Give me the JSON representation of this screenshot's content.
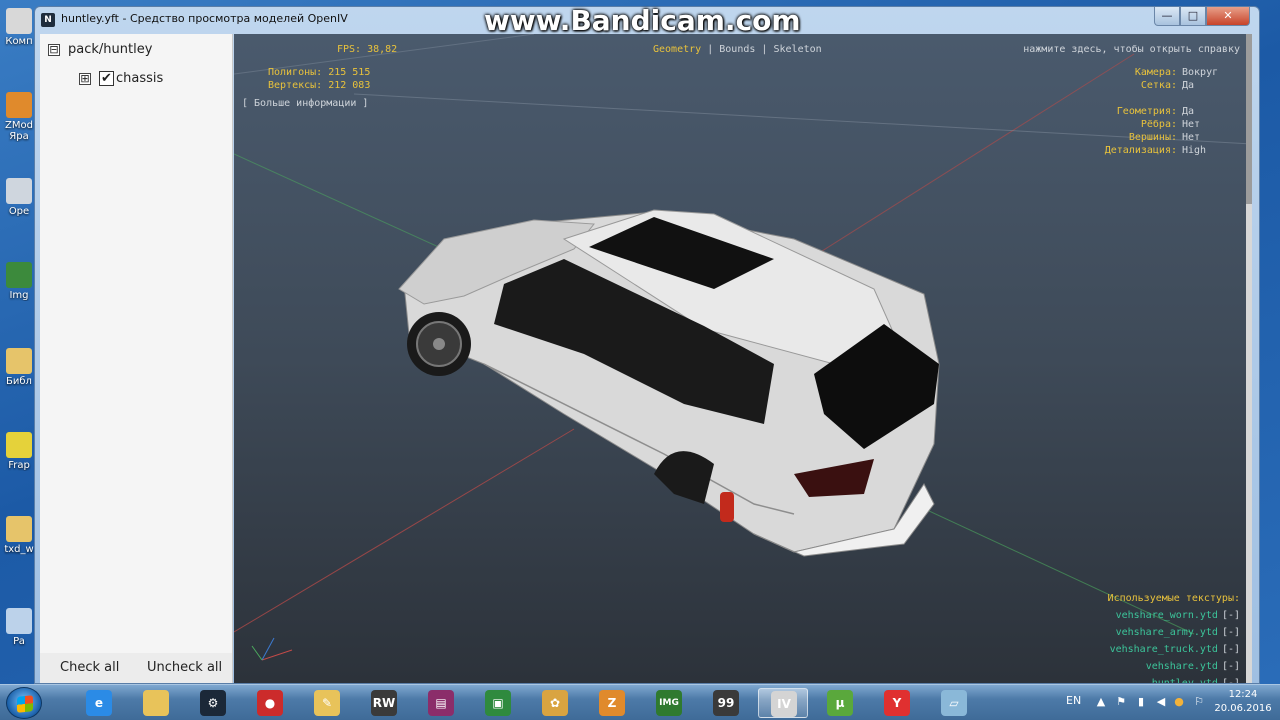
{
  "watermark": "www.Bandicam.com",
  "window": {
    "title": "huntley.yft - Средство просмотра моделей OpenIV",
    "app_icon": "N",
    "controls": {
      "minimize": "—",
      "maximize": "□",
      "close": "✕"
    }
  },
  "tree": {
    "root": {
      "expander": "⊟",
      "label": "pack/huntley"
    },
    "children": [
      {
        "expander": "⊞",
        "checked": "✔",
        "label": "chassis"
      }
    ]
  },
  "left_footer": {
    "check_all": "Check all",
    "uncheck_all": "Uncheck all"
  },
  "hud": {
    "fps": "FPS: 38,82",
    "polygons": "Полигоны: 215 515",
    "vertices": "Вертексы: 212 083",
    "more_info": "[ Больше информации ]",
    "tabs": {
      "geometry": "Geometry",
      "sep1": "|",
      "bounds": "Bounds",
      "sep2": "|",
      "skeleton": "Skeleton"
    },
    "help": "нажмите здесь, чтобы открыть справку",
    "settings": [
      {
        "label": "Камера:",
        "value": "Вокруг"
      },
      {
        "label": "Сетка:",
        "value": "Да"
      },
      {
        "label": "Геометрия:",
        "value": "Да"
      },
      {
        "label": "Рёбра:",
        "value": "Нет"
      },
      {
        "label": "Вершины:",
        "value": "Нет"
      },
      {
        "label": "Детализация:",
        "value": "High"
      }
    ],
    "textures_title": "Используемые текстуры:",
    "textures": [
      {
        "name": "vehshare_worn.ytd",
        "btn": "[-]"
      },
      {
        "name": "vehshare_army.ytd",
        "btn": "[-]"
      },
      {
        "name": "vehshare_truck.ytd",
        "btn": "[-]"
      },
      {
        "name": "vehshare.ytd",
        "btn": "[-]"
      },
      {
        "name": "huntley.ytd",
        "btn": "[-]"
      }
    ]
  },
  "desktop_icons": [
    {
      "label": "Комп",
      "icon": "computer-icon",
      "color": "#d8d8d8"
    },
    {
      "label": "ZMod",
      "label2": "Яра",
      "icon": "zmodeler-icon",
      "color": "#e08a2c"
    },
    {
      "label": "Ope",
      "icon": "openiv-icon",
      "color": "#cfd6de"
    },
    {
      "label": "Img",
      "icon": "img-tool-icon",
      "color": "#3c8a3c"
    },
    {
      "label": "Библ",
      "icon": "library-icon",
      "color": "#e6c46a"
    },
    {
      "label": "Frap",
      "icon": "fraps-icon",
      "color": "#e5d23a"
    },
    {
      "label": "txd_w",
      "icon": "txd-workshop-icon",
      "color": "#e6c46a"
    },
    {
      "label": "Pa",
      "icon": "paint-icon",
      "color": "#bcd2ea"
    }
  ],
  "taskbar": {
    "items": [
      {
        "name": "taskbar-ie-icon",
        "glyph": "e",
        "color": "#2b8be6"
      },
      {
        "name": "taskbar-explorer-icon",
        "glyph": "",
        "color": "#e8c35a"
      },
      {
        "name": "taskbar-steam-icon",
        "glyph": "⚙",
        "color": "#1b2838"
      },
      {
        "name": "taskbar-record-icon",
        "glyph": "●",
        "color": "#cc2b2b"
      },
      {
        "name": "taskbar-notes-icon",
        "glyph": "✎",
        "color": "#e8c35a"
      },
      {
        "name": "taskbar-rw-icon",
        "glyph": "RW",
        "color": "#3a3a3a"
      },
      {
        "name": "taskbar-winrar-icon",
        "glyph": "▤",
        "color": "#8b2d6a"
      },
      {
        "name": "taskbar-screen-icon",
        "glyph": "▣",
        "color": "#2f8a3e"
      },
      {
        "name": "taskbar-palette-icon",
        "glyph": "✿",
        "color": "#d9a441"
      },
      {
        "name": "taskbar-zmod-icon",
        "glyph": "Z",
        "color": "#e08a2c"
      },
      {
        "name": "taskbar-imged-icon",
        "glyph": "IMG",
        "color": "#2f7a2f"
      },
      {
        "name": "taskbar-fraps-icon",
        "glyph": "99",
        "color": "#3a3a3a"
      },
      {
        "name": "taskbar-openiv-icon",
        "glyph": "IV",
        "color": "#d4d4d4",
        "active": true
      },
      {
        "name": "taskbar-utorrent-icon",
        "glyph": "µ",
        "color": "#5aa83c"
      },
      {
        "name": "taskbar-yandex-icon",
        "glyph": "Y",
        "color": "#e03030"
      },
      {
        "name": "taskbar-doc-icon",
        "glyph": "▱",
        "color": "#8ab8d8"
      }
    ],
    "lang": "EN",
    "clock_time": "12:24",
    "clock_date": "20.06.2016"
  }
}
